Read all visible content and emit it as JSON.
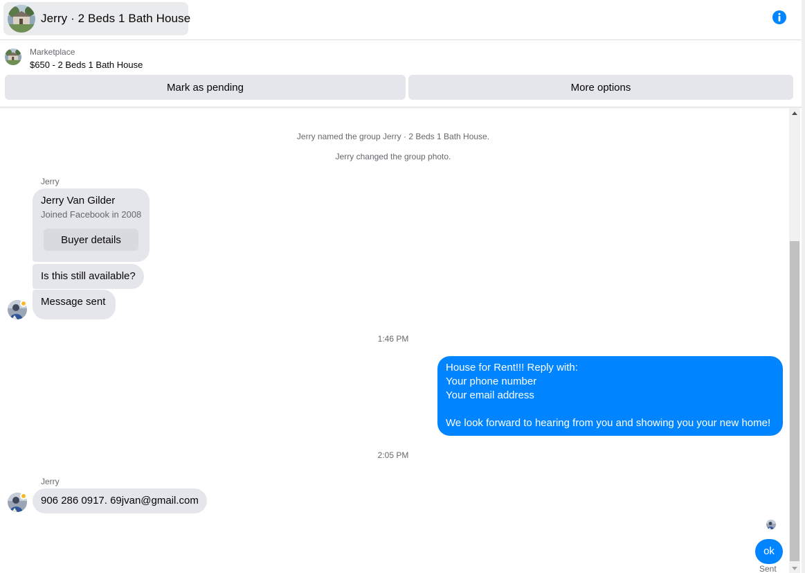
{
  "header": {
    "title": "Jerry · 2 Beds 1 Bath House",
    "info_icon": "info-circle-icon",
    "accent": "#0084ff"
  },
  "marketplace": {
    "label": "Marketplace",
    "item": "$650 - 2 Beds 1 Bath House",
    "mark_pending": "Mark as pending",
    "more_options": "More options"
  },
  "thread": {
    "system_1": "Jerry named the group Jerry · 2 Beds 1 Bath House.",
    "system_2": "Jerry changed the group photo.",
    "sender_1": "Jerry",
    "profile": {
      "name": "Jerry Van Gilder",
      "joined": "Joined Facebook in 2008",
      "button": "Buyer details"
    },
    "msg_available": "Is this still available?",
    "msg_sent_note": "Message sent",
    "time_1": "1:46 PM",
    "outgoing_1": "House for Rent!!! Reply with:\nYour phone number\nYour email address\n\nWe look forward to hearing from you and showing you your new home!",
    "time_2": "2:05 PM",
    "sender_2": "Jerry",
    "msg_contact": "906 286 0917. 69jvan@gmail.com",
    "outgoing_2": "ok",
    "status": "Sent"
  },
  "colors": {
    "incoming_bubble": "#e4e6eb",
    "outgoing_bubble": "#0084ff",
    "meta_text": "#65676b"
  }
}
